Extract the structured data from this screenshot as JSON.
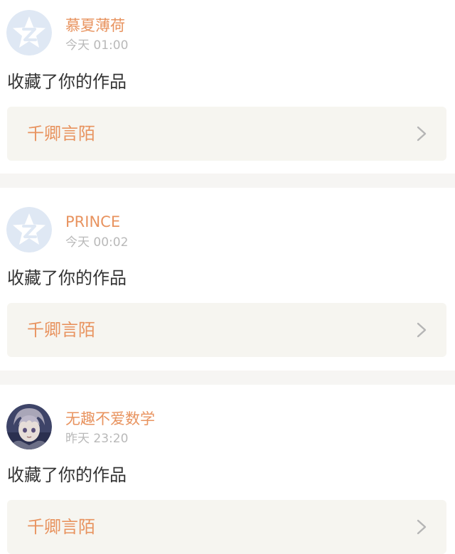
{
  "notifications": [
    {
      "username": "慕夏薄荷",
      "time": "今天 01:00",
      "action": "收藏了你的作品",
      "work_title": "千卿言陌",
      "avatar": "qzone-default-avatar"
    },
    {
      "username": "PRINCE",
      "time": "今天 00:02",
      "action": "收藏了你的作品",
      "work_title": "千卿言陌",
      "avatar": "qzone-default-avatar"
    },
    {
      "username": "无趣不爱数学",
      "time": "昨天 23:20",
      "action": "收藏了你的作品",
      "work_title": "千卿言陌",
      "avatar": "anime-character-avatar"
    }
  ],
  "colors": {
    "username": "#e8935f",
    "work_title": "#e8935f",
    "timestamp": "#b9b9b9",
    "body_text": "#333333",
    "link_card_bg": "#f6f5f0",
    "separator": "#f6f5f3",
    "default_avatar": "#dfe8f4"
  },
  "icons": {
    "chevron": "chevron-right-icon"
  }
}
